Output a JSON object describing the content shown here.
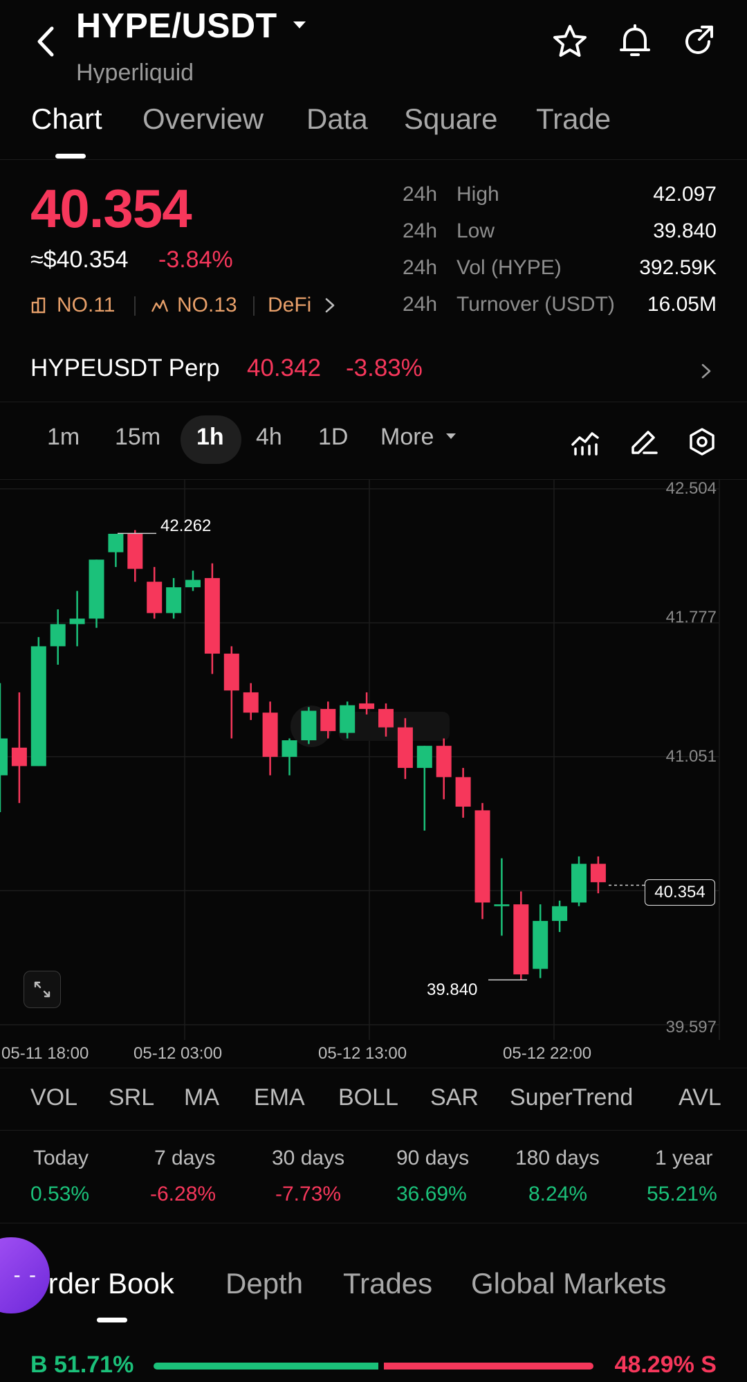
{
  "header": {
    "title": "HYPE/USDT",
    "subtitle": "Hyperliquid"
  },
  "tabs": [
    {
      "label": "Chart",
      "active": true
    },
    {
      "label": "Overview",
      "active": false
    },
    {
      "label": "Data",
      "active": false
    },
    {
      "label": "Square",
      "active": false
    },
    {
      "label": "Trade",
      "active": false
    }
  ],
  "price": {
    "last": "40.354",
    "usd": "≈$40.354",
    "change": "-3.84%",
    "rank1": "NO.11",
    "rank2": "NO.13",
    "category": "DeFi"
  },
  "stats": [
    {
      "period": "24h",
      "label": "High",
      "value": "42.097"
    },
    {
      "period": "24h",
      "label": "Low",
      "value": "39.840"
    },
    {
      "period": "24h",
      "label": "Vol (HYPE)",
      "value": "392.59K"
    },
    {
      "period": "24h",
      "label": "Turnover (USDT)",
      "value": "16.05M"
    }
  ],
  "perp": {
    "name": "HYPEUSDT Perp",
    "price": "40.342",
    "change": "-3.83%"
  },
  "intervals": [
    {
      "label": "1m",
      "active": false
    },
    {
      "label": "15m",
      "active": false
    },
    {
      "label": "1h",
      "active": true
    },
    {
      "label": "4h",
      "active": false
    },
    {
      "label": "1D",
      "active": false
    },
    {
      "label": "More",
      "active": false
    }
  ],
  "chart_data": {
    "type": "candlestick",
    "y_ticks": [
      "42.504",
      "41.777",
      "41.051",
      "39.597"
    ],
    "ylim": [
      39.597,
      42.504
    ],
    "x_ticks": [
      "05-11 18:00",
      "05-12 03:00",
      "05-12 13:00",
      "05-12 22:00"
    ],
    "high_label": "42.262",
    "low_label": "39.840",
    "current_label": "40.354",
    "current_value": 40.354,
    "candles": [
      {
        "o": 40.95,
        "h": 41.45,
        "l": 40.75,
        "c": 41.15
      },
      {
        "o": 41.1,
        "h": 41.4,
        "l": 40.8,
        "c": 41.0
      },
      {
        "o": 41.0,
        "h": 41.7,
        "l": 41.0,
        "c": 41.65
      },
      {
        "o": 41.65,
        "h": 41.85,
        "l": 41.55,
        "c": 41.77
      },
      {
        "o": 41.77,
        "h": 41.95,
        "l": 41.65,
        "c": 41.8
      },
      {
        "o": 41.8,
        "h": 42.12,
        "l": 41.75,
        "c": 42.12
      },
      {
        "o": 42.16,
        "h": 42.26,
        "l": 42.08,
        "c": 42.26
      },
      {
        "o": 42.26,
        "h": 42.28,
        "l": 42.0,
        "c": 42.07
      },
      {
        "o": 42.0,
        "h": 42.08,
        "l": 41.8,
        "c": 41.83
      },
      {
        "o": 41.83,
        "h": 42.02,
        "l": 41.8,
        "c": 41.97
      },
      {
        "o": 41.97,
        "h": 42.06,
        "l": 41.95,
        "c": 42.01
      },
      {
        "o": 42.02,
        "h": 42.1,
        "l": 41.5,
        "c": 41.61
      },
      {
        "o": 41.61,
        "h": 41.65,
        "l": 41.15,
        "c": 41.41
      },
      {
        "o": 41.4,
        "h": 41.45,
        "l": 41.25,
        "c": 41.29
      },
      {
        "o": 41.29,
        "h": 41.35,
        "l": 40.95,
        "c": 41.05
      },
      {
        "o": 41.05,
        "h": 41.15,
        "l": 40.95,
        "c": 41.14
      },
      {
        "o": 41.14,
        "h": 41.32,
        "l": 41.12,
        "c": 41.3
      },
      {
        "o": 41.31,
        "h": 41.35,
        "l": 41.15,
        "c": 41.19
      },
      {
        "o": 41.18,
        "h": 41.35,
        "l": 41.15,
        "c": 41.33
      },
      {
        "o": 41.34,
        "h": 41.4,
        "l": 41.28,
        "c": 41.31
      },
      {
        "o": 41.31,
        "h": 41.34,
        "l": 41.16,
        "c": 41.21
      },
      {
        "o": 41.21,
        "h": 41.26,
        "l": 40.93,
        "c": 40.99
      },
      {
        "o": 40.99,
        "h": 41.11,
        "l": 40.65,
        "c": 41.11
      },
      {
        "o": 41.11,
        "h": 41.15,
        "l": 40.82,
        "c": 40.94
      },
      {
        "o": 40.94,
        "h": 40.99,
        "l": 40.72,
        "c": 40.78
      },
      {
        "o": 40.76,
        "h": 40.8,
        "l": 40.17,
        "c": 40.26
      },
      {
        "o": 40.24,
        "h": 40.5,
        "l": 40.08,
        "c": 40.25
      },
      {
        "o": 40.25,
        "h": 40.32,
        "l": 39.84,
        "c": 39.87
      },
      {
        "o": 39.9,
        "h": 40.25,
        "l": 39.85,
        "c": 40.16
      },
      {
        "o": 40.16,
        "h": 40.27,
        "l": 40.1,
        "c": 40.24
      },
      {
        "o": 40.26,
        "h": 40.51,
        "l": 40.24,
        "c": 40.47
      },
      {
        "o": 40.47,
        "h": 40.51,
        "l": 40.31,
        "c": 40.37
      }
    ]
  },
  "indicators": [
    "VOL",
    "SRL",
    "MA",
    "EMA",
    "BOLL",
    "SAR",
    "SuperTrend",
    "AVL"
  ],
  "performance": [
    {
      "label": "Today",
      "value": "0.53%",
      "dir": "up"
    },
    {
      "label": "7 days",
      "value": "-6.28%",
      "dir": "down"
    },
    {
      "label": "30 days",
      "value": "-7.73%",
      "dir": "down"
    },
    {
      "label": "90 days",
      "value": "36.69%",
      "dir": "up"
    },
    {
      "label": "180 days",
      "value": "8.24%",
      "dir": "up"
    },
    {
      "label": "1 year",
      "value": "55.21%",
      "dir": "up"
    }
  ],
  "order_tabs": [
    {
      "label": "Order Book",
      "active": true
    },
    {
      "label": "Depth",
      "active": false
    },
    {
      "label": "Trades",
      "active": false
    },
    {
      "label": "Global Markets",
      "active": false
    }
  ],
  "book_ratio": {
    "buy": "B 51.71%",
    "sell": "48.29% S",
    "buy_fraction": 0.5171
  },
  "fab_label": "- -",
  "colors": {
    "up": "#1bc17a",
    "down": "#f6375b",
    "accent": "#e8a06a"
  }
}
